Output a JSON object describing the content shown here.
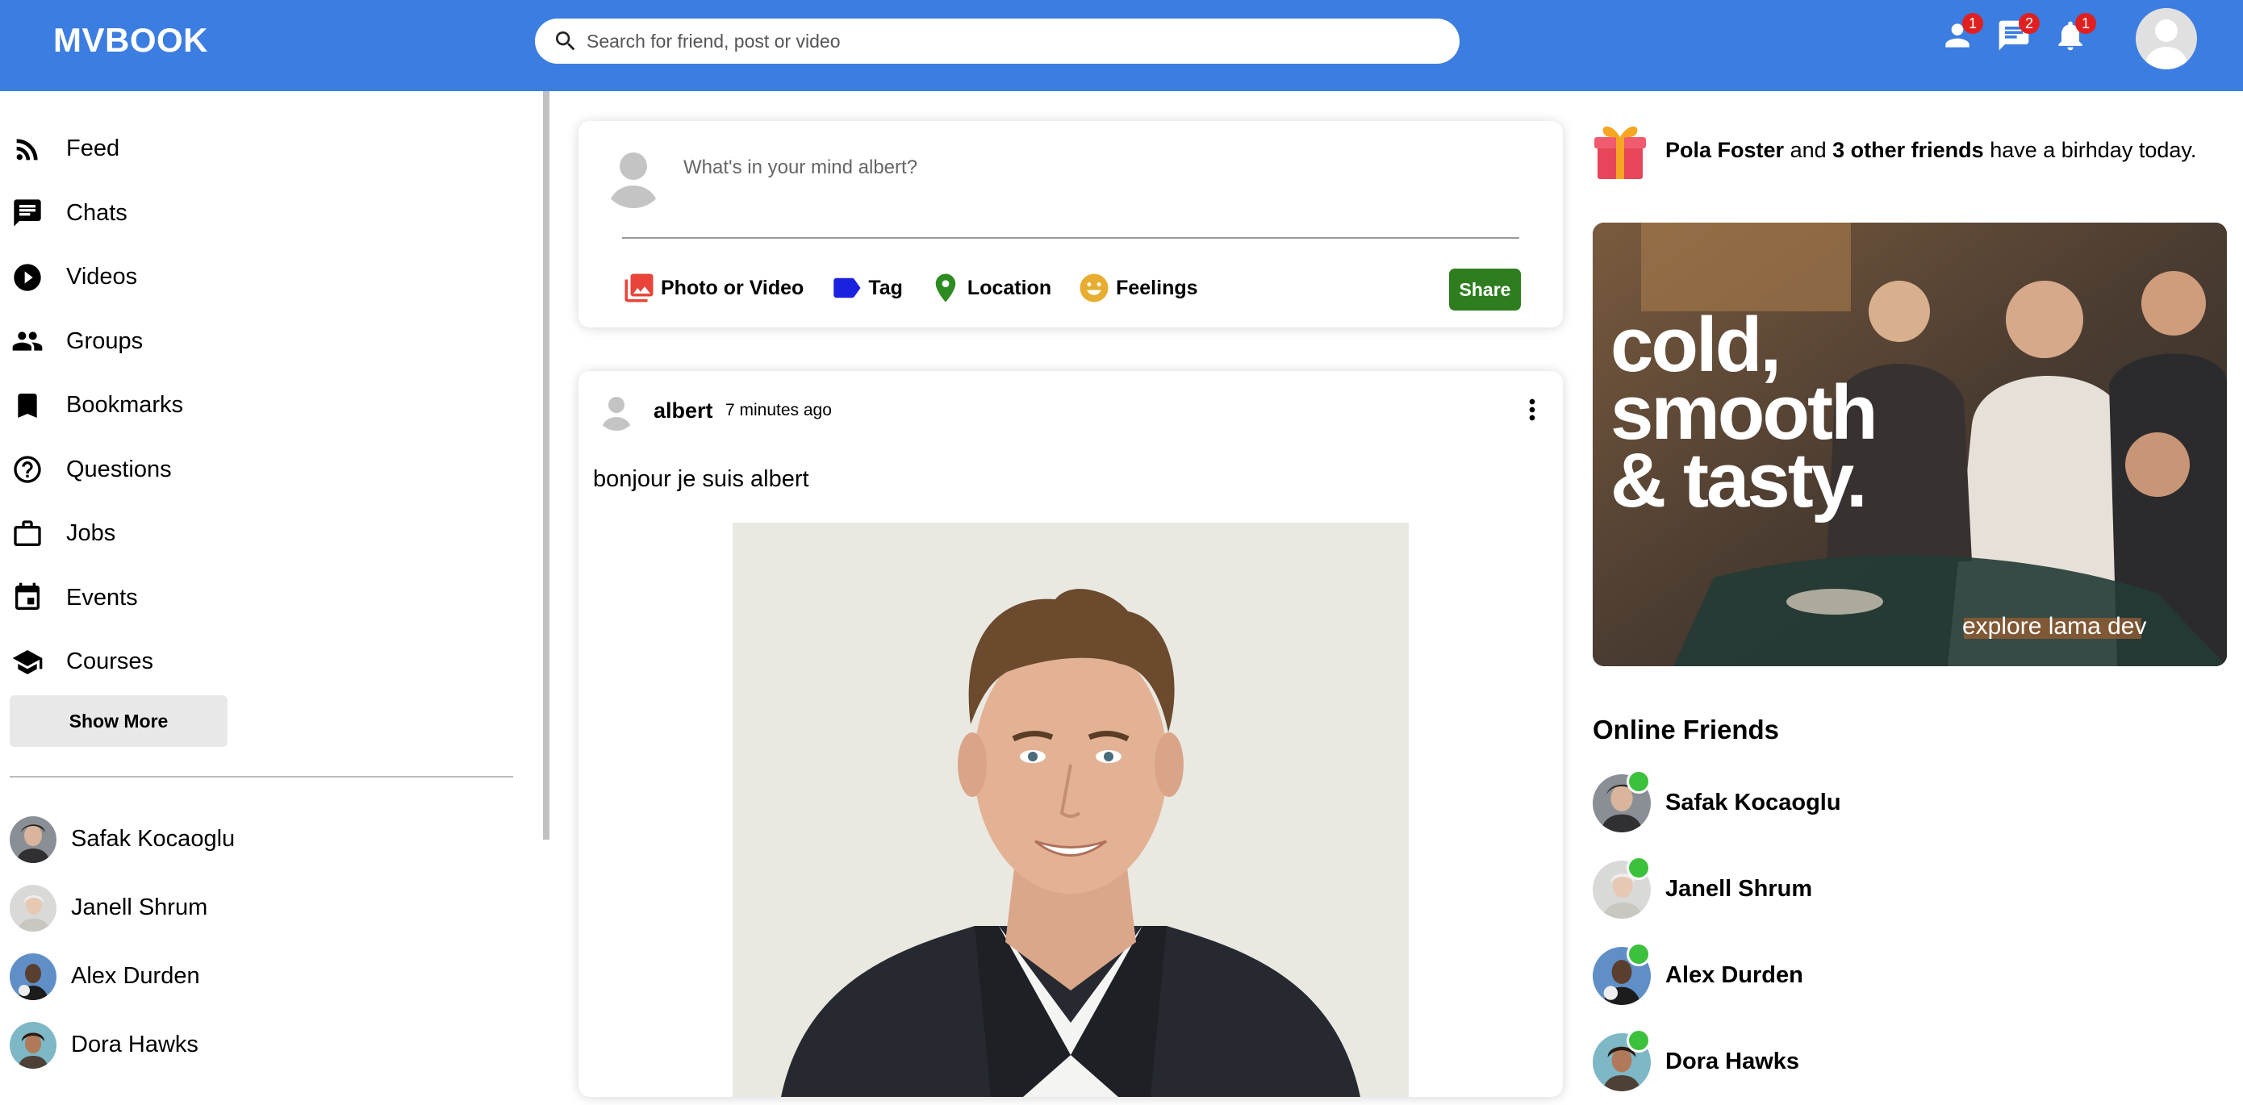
{
  "brand": {
    "logo": "MVBOOK",
    "accent": "#3b7de0"
  },
  "search": {
    "placeholder": "Search for friend, post or video"
  },
  "topbar": {
    "badges": {
      "friends": "1",
      "messages": "2",
      "notifications": "1"
    }
  },
  "sidebar": {
    "items": [
      {
        "label": "Feed",
        "icon": "rss-icon"
      },
      {
        "label": "Chats",
        "icon": "chat-icon"
      },
      {
        "label": "Videos",
        "icon": "play-circle-icon"
      },
      {
        "label": "Groups",
        "icon": "group-icon"
      },
      {
        "label": "Bookmarks",
        "icon": "bookmark-icon"
      },
      {
        "label": "Questions",
        "icon": "help-circle-icon"
      },
      {
        "label": "Jobs",
        "icon": "briefcase-icon"
      },
      {
        "label": "Events",
        "icon": "calendar-icon"
      },
      {
        "label": "Courses",
        "icon": "school-icon"
      }
    ],
    "show_more": "Show More",
    "friends": [
      "Safak Kocaoglu",
      "Janell Shrum",
      "Alex Durden",
      "Dora Hawks"
    ]
  },
  "share": {
    "placeholder": "What's in your mind albert?",
    "options": [
      "Photo or Video",
      "Tag",
      "Location",
      "Feelings"
    ],
    "button": "Share"
  },
  "post": {
    "user": "albert",
    "time": "7 minutes ago",
    "text": "bonjour je suis albert"
  },
  "rightbar": {
    "birthday": {
      "name": "Pola Foster",
      "connector": "and",
      "others": "3 other friends",
      "suffix": "have a birhday today."
    },
    "ad": {
      "line1": "cold,",
      "line2": "smooth",
      "line3": "& tasty.",
      "tagline": "explore lama dev"
    },
    "online_title": "Online Friends",
    "online": [
      "Safak Kocaoglu",
      "Janell Shrum",
      "Alex Durden",
      "Dora Hawks"
    ]
  }
}
